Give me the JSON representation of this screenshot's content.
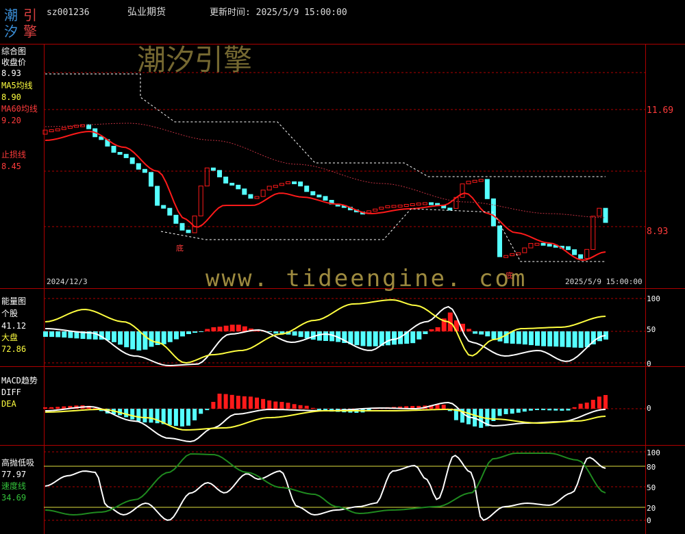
{
  "header": {
    "logo_chars": [
      "潮",
      "引",
      "汐",
      "擎"
    ],
    "code": "sz001236",
    "name": "弘业期货",
    "update_label": "更新时间: 2025/5/9 15:00:00"
  },
  "watermarks": {
    "brand": "潮汐引擎",
    "url": "www. tideengine. com"
  },
  "main_panel": {
    "title": "综合图",
    "close_label": "收盘价",
    "close_value": "8.93",
    "ma5_label": "MA5均线",
    "ma5_value": "8.90",
    "ma60_label": "MA60均线",
    "ma60_value": "9.20",
    "stop_label": "止损线",
    "stop_value": "8.45",
    "price_high": "11.69",
    "price_low": "8.93",
    "date_start": "2024/12/3",
    "date_end": "2025/5/9 15:00:00",
    "bottom_marks": [
      "底",
      "底"
    ]
  },
  "energy_panel": {
    "title": "能量图",
    "stock_label": "个股",
    "stock_value": "41.12",
    "market_label": "大盘",
    "market_value": "72.86",
    "axis": [
      "100",
      "50",
      "0"
    ]
  },
  "macd_panel": {
    "title": "MACD趋势",
    "diff_label": "DIFF",
    "dea_label": "DEA",
    "axis": [
      "0"
    ]
  },
  "kdj_panel": {
    "title": "高抛低吸",
    "value": "77.97",
    "speed_label": "速度线",
    "speed_value": "34.69",
    "axis": [
      "100",
      "80",
      "50",
      "20",
      "0"
    ]
  },
  "colors": {
    "up": "#ff1a1a",
    "down": "#55ffff",
    "ma5": "#ff1a1a",
    "ma60": "#c03040",
    "grid": "#b00000",
    "stock_line": "#ffffff",
    "market_line": "#ffff40",
    "speed_line": "#1f8a1f"
  }
}
